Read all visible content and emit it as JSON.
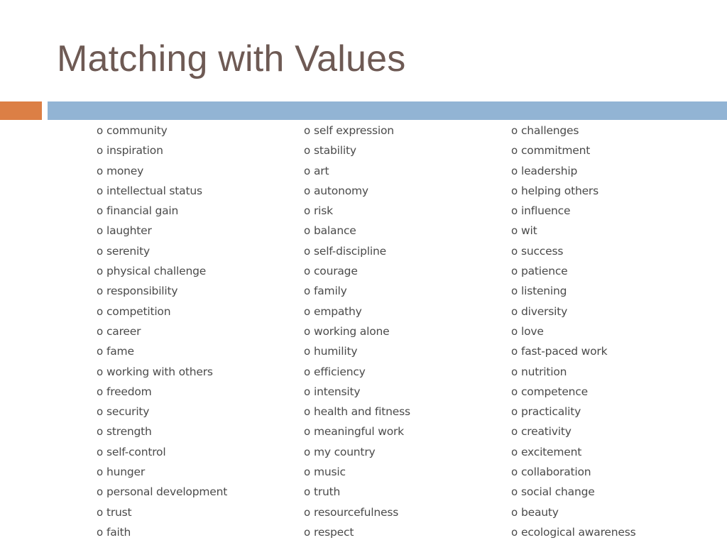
{
  "slide": {
    "title": "Matching with Values",
    "colors": {
      "title": "#6e5a54",
      "accent_orange": "#dc7f45",
      "accent_blue": "#92b4d4",
      "text": "#4a4a4a"
    },
    "bullet_glyph": "o",
    "columns": [
      {
        "items": [
          "community",
          "inspiration",
          "money",
          "intellectual status",
          "financial gain",
          "laughter",
          "serenity",
          "physical challenge",
          "responsibility",
          "competition",
          "career",
          "fame",
          "working with others",
          "freedom",
          "security",
          "strength",
          "self-control",
          "hunger",
          "personal development",
          "trust",
          "faith"
        ]
      },
      {
        "items": [
          "self expression",
          "stability",
          "art",
          "autonomy",
          "risk",
          "balance",
          "self-discipline",
          "courage",
          "family",
          "empathy",
          "working alone",
          "humility",
          "efficiency",
          "intensity",
          "health and fitness",
          "meaningful work",
          "my country",
          "music",
          "truth",
          "resourcefulness",
          "respect"
        ]
      },
      {
        "items": [
          "challenges",
          "commitment",
          "leadership",
          "helping others",
          "influence",
          "wit",
          "success",
          "patience",
          "listening",
          "diversity",
          "love",
          "fast-paced work",
          "nutrition",
          "competence",
          "practicality",
          "creativity",
          "excitement",
          "collaboration",
          "social change",
          "beauty",
          "ecological awareness"
        ]
      }
    ]
  }
}
